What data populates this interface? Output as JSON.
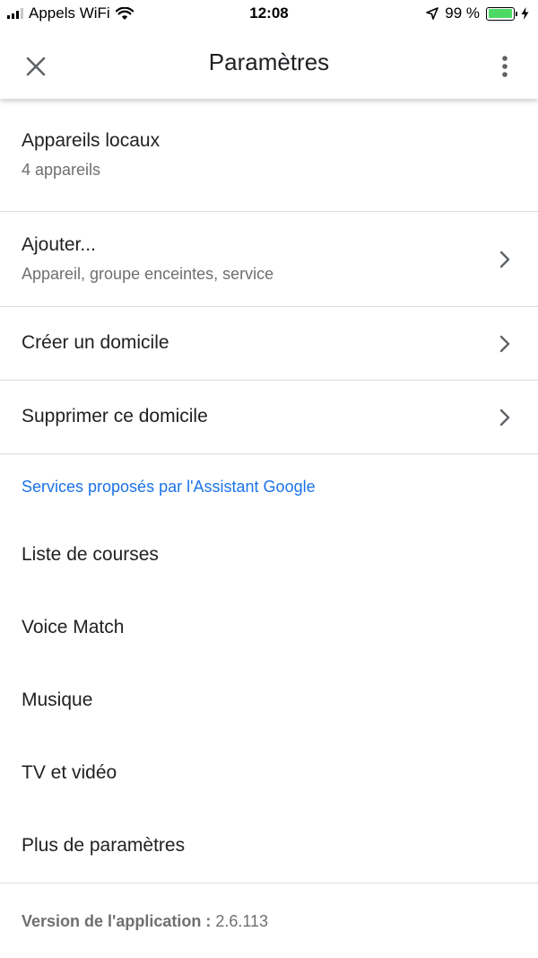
{
  "status_bar": {
    "carrier": "Appels WiFi",
    "time": "12:08",
    "battery_text": "99 %",
    "battery_level": 0.99,
    "icons": [
      "signal-icon",
      "wifi-icon",
      "location-arrow-icon",
      "battery-icon",
      "charging-bolt-icon"
    ]
  },
  "app_bar": {
    "title": "Paramètres",
    "icons": [
      "close-icon",
      "more-vert-icon"
    ]
  },
  "items": [
    {
      "title": "Appareils locaux",
      "subtitle": "4 appareils"
    },
    {
      "title": "Ajouter...",
      "subtitle": "Appareil, groupe enceintes, service"
    },
    {
      "title": "Créer un domicile"
    },
    {
      "title": "Supprimer ce domicile"
    }
  ],
  "assistant_section": {
    "header": "Services proposés par l'Assistant Google",
    "items": [
      "Liste de courses",
      "Voice Match",
      "Musique",
      "TV et vidéo",
      "Plus de paramètres"
    ]
  },
  "footer": {
    "version_label": "Version de l'application :",
    "version_value": "2.6.113"
  },
  "colors": {
    "accent": "#1a73e8",
    "text": "#202124",
    "secondary_text": "#6f6f6f",
    "divider": "#dadce0",
    "battery_green": "#4cd964"
  }
}
